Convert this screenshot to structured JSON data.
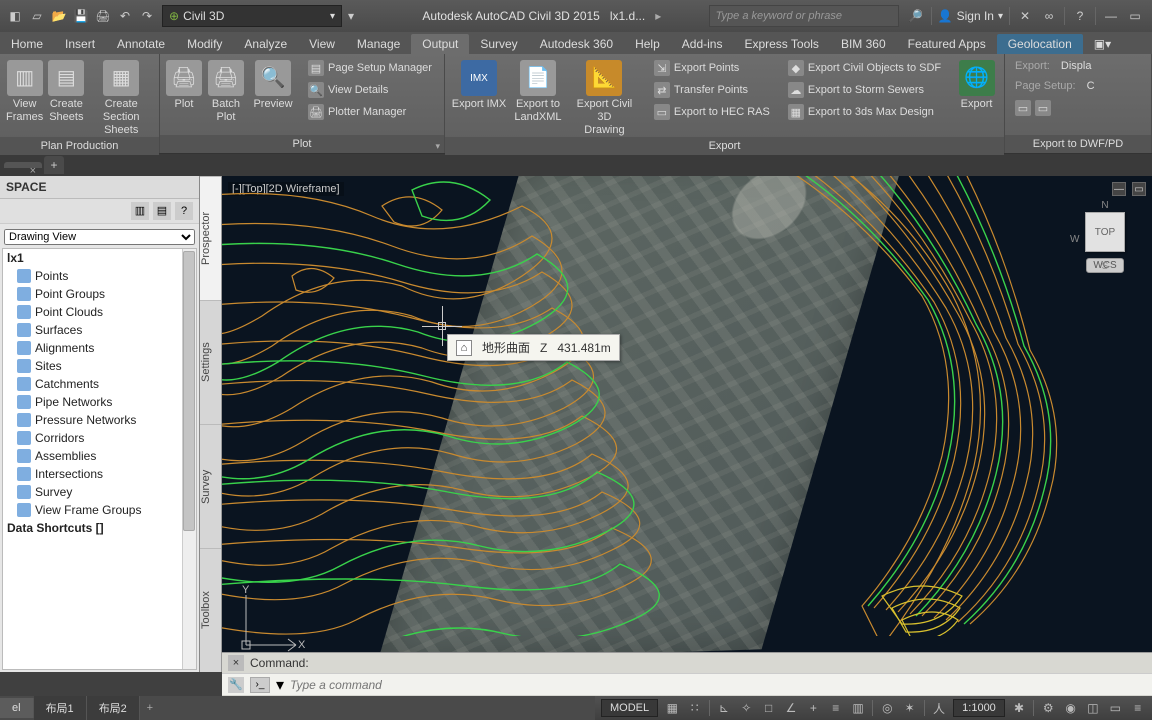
{
  "app": {
    "title": "Autodesk AutoCAD Civil 3D 2015",
    "doc": "lx1.d...",
    "workspace": "Civil 3D",
    "search_placeholder": "Type a keyword or phrase",
    "signin": "Sign In"
  },
  "ribbon_tabs": [
    "Home",
    "Insert",
    "Annotate",
    "Modify",
    "Analyze",
    "View",
    "Manage",
    "Output",
    "Survey",
    "Autodesk 360",
    "Help",
    "Add-ins",
    "Express Tools",
    "BIM 360",
    "Featured Apps",
    "Geolocation"
  ],
  "ribbon_active": "Output",
  "panels": {
    "plan": {
      "title": "Plan Production",
      "btns": [
        {
          "label": "View\nFrames",
          "icon": "▥"
        },
        {
          "label": "Create\nSheets",
          "icon": "▤"
        },
        {
          "label": "Create\nSection Sheets",
          "icon": "▦"
        }
      ]
    },
    "plot": {
      "title": "Plot",
      "btns": [
        {
          "label": "Plot",
          "icon": "🖨"
        },
        {
          "label": "Batch\nPlot",
          "icon": "🖨"
        },
        {
          "label": "Preview",
          "icon": "🔍"
        }
      ],
      "rows": [
        {
          "label": "Page Setup Manager"
        },
        {
          "label": "View Details"
        },
        {
          "label": "Plotter Manager"
        }
      ]
    },
    "export": {
      "title": "Export",
      "btns": [
        {
          "label": "Export IMX",
          "icon": "IMX"
        },
        {
          "label": "Export to\nLandXML",
          "icon": "XML"
        },
        {
          "label": "Export Civil 3D\nDrawing",
          "icon": "C3D"
        }
      ],
      "rows1": [
        {
          "label": "Export Points"
        },
        {
          "label": "Transfer Points"
        },
        {
          "label": "Export to HEC RAS"
        }
      ],
      "rows2": [
        {
          "label": "Export Civil Objects to SDF"
        },
        {
          "label": "Export to Storm Sewers"
        },
        {
          "label": "Export to 3ds Max Design"
        }
      ],
      "btn2": {
        "label": "Export",
        "icon": "🌐"
      }
    },
    "dwf": {
      "title": "Export to DWF/PD",
      "rows": [
        {
          "k": "Export:",
          "v": "Displa"
        },
        {
          "k": "Page Setup:",
          "v": "C"
        }
      ]
    }
  },
  "doctab": {
    "name": "",
    "add": "+"
  },
  "toolspace": {
    "title": "SPACE",
    "view_label": "Drawing View",
    "root": "lx1",
    "items": [
      "Points",
      "Point Groups",
      "Point Clouds",
      "Surfaces",
      "Alignments",
      "Sites",
      "Catchments",
      "Pipe Networks",
      "Pressure Networks",
      "Corridors",
      "Assemblies",
      "Intersections",
      "Survey",
      "View Frame Groups"
    ],
    "shortcuts": "Data Shortcuts []"
  },
  "vtabs": [
    "Prospector",
    "Settings",
    "Survey",
    "Toolbox"
  ],
  "viewport": {
    "label": "[-][Top][2D Wireframe]",
    "tooltip": {
      "name": "地形曲面",
      "axis": "Z",
      "value": "431.481m"
    },
    "viewcube": {
      "top": "TOP",
      "n": "N",
      "s": "S",
      "w": "W",
      "wcs": "WCS"
    },
    "ucs": {
      "x": "X",
      "y": "Y"
    }
  },
  "command": {
    "history_label": "Command:",
    "placeholder": "Type a command"
  },
  "layouts": {
    "tabs": [
      "el",
      "布局1",
      "布局2"
    ],
    "active": 0
  },
  "status": {
    "mode": "MODEL",
    "scale": "1:1000"
  }
}
